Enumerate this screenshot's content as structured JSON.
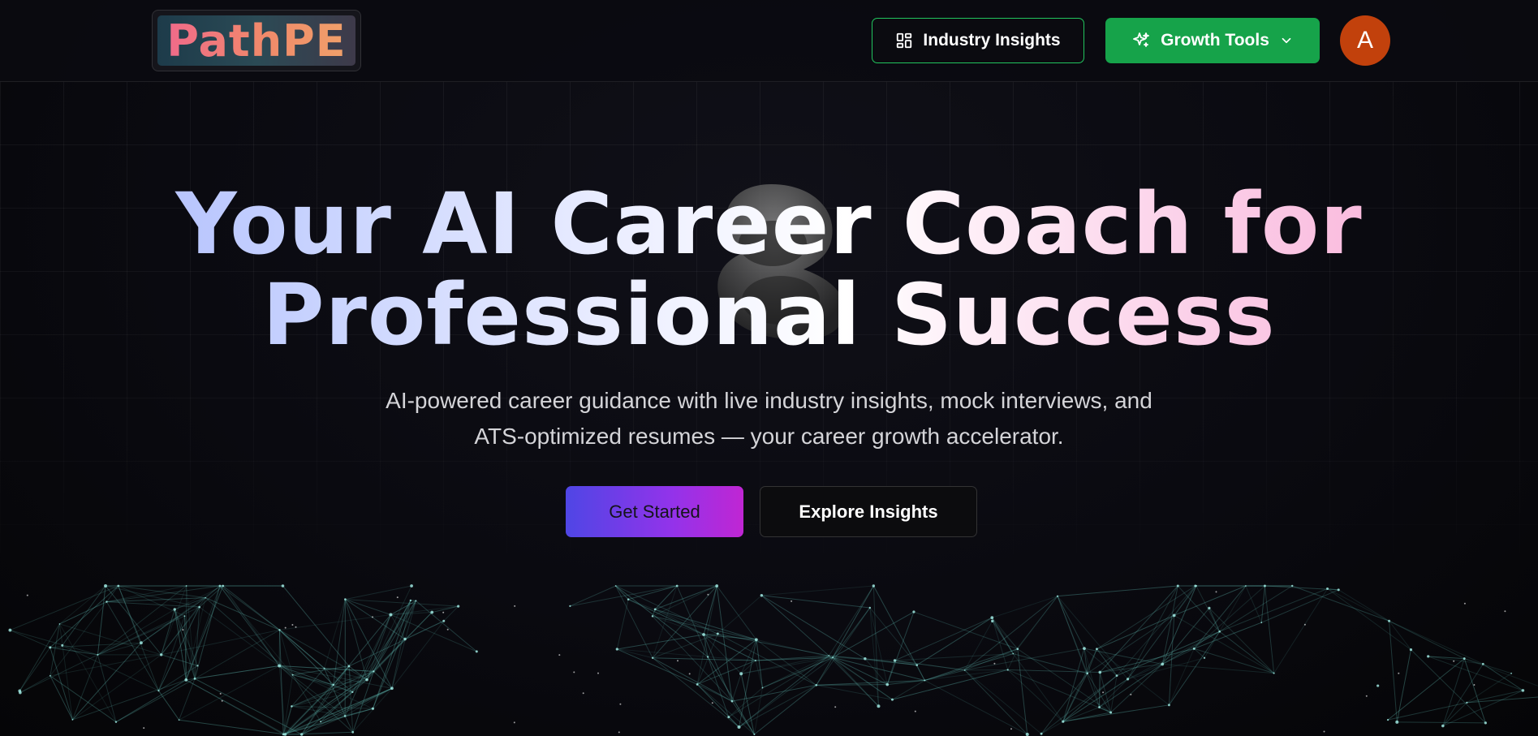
{
  "header": {
    "logo_text": "PathPE",
    "industry_insights_label": "Industry Insights",
    "industry_insights_icon": "grid-dashboard-icon",
    "growth_tools_label": "Growth Tools",
    "growth_tools_icon": "sparkles-icon",
    "growth_tools_caret_icon": "chevron-down-icon",
    "avatar_initial": "A"
  },
  "hero": {
    "title_line1": "Your AI Career Coach for",
    "title_line2": "Professional Success",
    "subtitle_line1": "AI-powered career guidance with live industry insights, mock interviews, and",
    "subtitle_line2": "ATS-optimized resumes — your career growth accelerator.",
    "primary_button": "Get Started",
    "secondary_button": "Explore Insights"
  },
  "colors": {
    "accent_green": "#16a34a",
    "avatar_bg": "#c2410c",
    "primary_gradient_start": "#4f46e5",
    "primary_gradient_end": "#c026d3"
  }
}
